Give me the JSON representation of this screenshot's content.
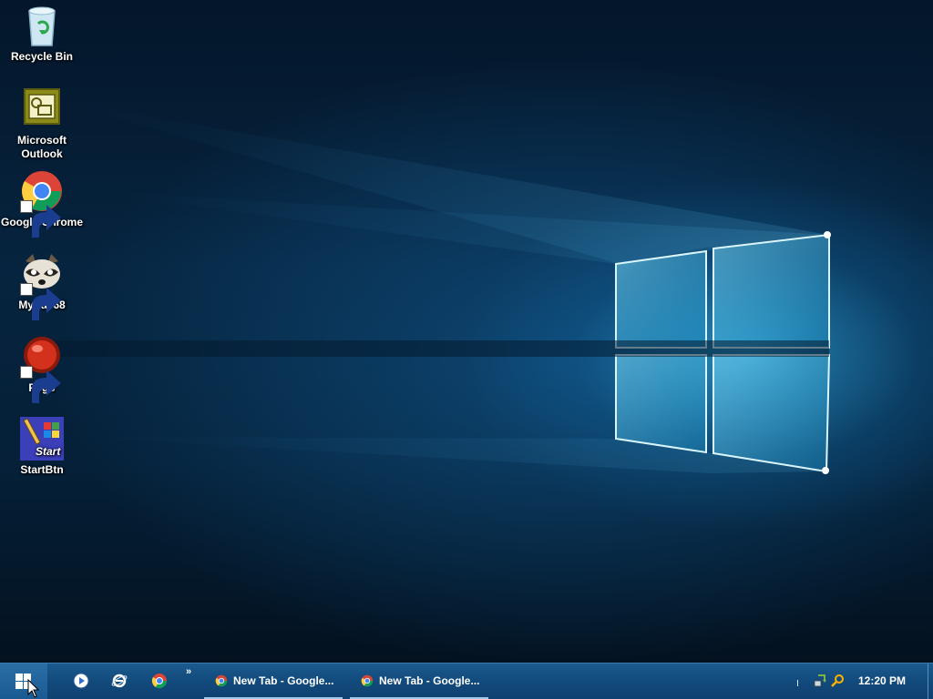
{
  "desktop_icons": [
    {
      "label": "Recycle Bin",
      "icon": "recycle-bin-icon"
    },
    {
      "label": "Microsoft\nOutlook",
      "icon": "outlook-icon"
    },
    {
      "label": "Google Chrome",
      "icon": "chrome-icon"
    },
    {
      "label": "MyPal 68",
      "icon": "mypal-icon"
    },
    {
      "label": "Pego",
      "icon": "pego-icon"
    },
    {
      "label": "StartBtn",
      "icon": "startbtn-icon"
    }
  ],
  "startbtn_icon_text": "Start",
  "taskbar": {
    "start_icon": "windows-logo-icon",
    "quick_launch": [
      {
        "icon": "media-player-icon"
      },
      {
        "icon": "internet-explorer-icon"
      },
      {
        "icon": "chrome-icon"
      }
    ],
    "quick_launch_overflow": "»",
    "tasks": [
      {
        "label": "New Tab - Google...",
        "icon": "chrome-icon"
      },
      {
        "label": "New Tab - Google...",
        "icon": "chrome-icon"
      }
    ],
    "tray": {
      "icons": [
        "network-icon",
        "search-tray-icon"
      ],
      "clock": "12:20 PM"
    }
  },
  "colors": {
    "taskbar": "#124a7c",
    "wallpaper_glow": "#3cc8ff",
    "task_underline": "#9fc7ea"
  }
}
